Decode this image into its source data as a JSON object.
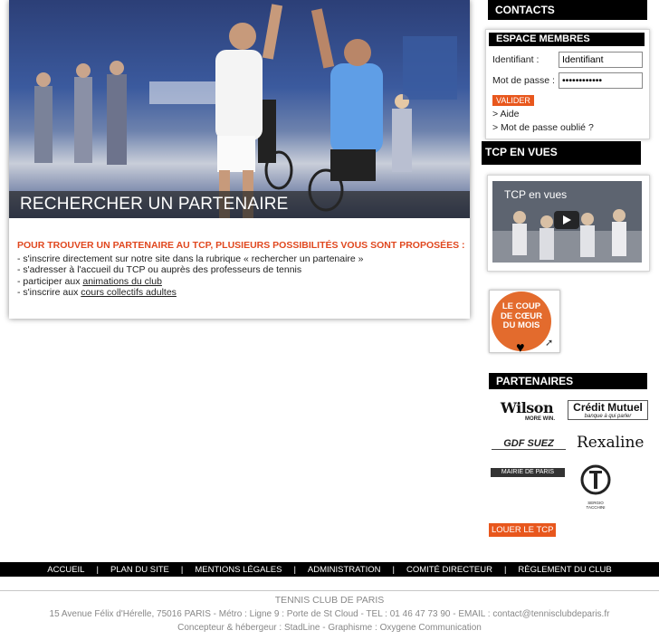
{
  "hero": {
    "banner_title": "RECHERCHER UN PARTENAIRE"
  },
  "intro": {
    "heading": "POUR TROUVER UN PARTENAIRE AU TCP, PLUSIEURS POSSIBILITÉS VOUS SONT PROPOSÉES :",
    "line1": "- s'inscrire directement sur notre site dans la rubrique « rechercher un partenaire »",
    "line2": "- s'adresser à l'accueil du TCP ou auprès des professeurs de tennis",
    "line3_prefix": "- participer aux ",
    "line3_link": "animations du club",
    "line4_prefix": "- s'inscrire aux ",
    "line4_link": "cours collectifs adultes"
  },
  "contacts": {
    "title": "CONTACTS"
  },
  "membres": {
    "title": "ESPACE MEMBRES",
    "id_label": "Identifiant :",
    "id_value": "Identifiant",
    "pw_label": "Mot de passe :",
    "pw_value": "••••••••••••",
    "submit": "VALIDER",
    "help": "> Aide",
    "forgot": "> Mot de passe oublié ?"
  },
  "tcp_vues": {
    "title": "TCP EN VUES",
    "video_title": "TCP en vues"
  },
  "coup": {
    "text": "LE COUP DE CŒUR DU MOIS"
  },
  "partenaires": {
    "title": "PARTENAIRES",
    "wilson": "Wilson",
    "wilson_tag": "MORE WIN.",
    "credit": "Crédit Mutuel",
    "credit_tag": "banque à qui parler",
    "gdf": "GDF SUEZ",
    "rexaline": "Rexaline",
    "mairie": "MAIRIE DE PARIS",
    "tacchini": "SERGIO TACCHINI"
  },
  "louer": {
    "label": "LOUER LE TCP"
  },
  "footer": {
    "nav": [
      "ACCUEIL",
      "PLAN DU SITE",
      "MENTIONS LÉGALES",
      "ADMINISTRATION",
      "COMITÉ DIRECTEUR",
      "RÈGLEMENT DU CLUB"
    ],
    "club": "TENNIS CLUB DE PARIS",
    "address": "15 Avenue Félix d'Hérelle, 75016 PARIS - Métro : Ligne 9 : Porte de St Cloud - TEL : 01 46 47 73 90 - EMAIL : contact@tennisclubdeparis.fr",
    "credits": "Concepteur & hébergeur : StadLine - Graphisme : Oxygene Communication"
  },
  "colors": {
    "accent": "#e8571d",
    "header_bg": "#000000"
  }
}
